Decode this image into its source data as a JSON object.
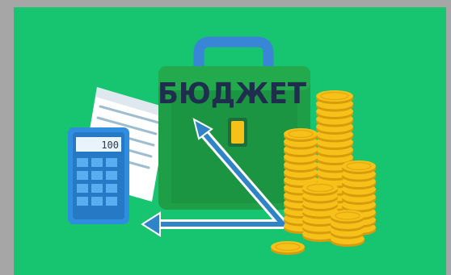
{
  "banner": {
    "title": "БЮДЖЕТ",
    "calculator_display": "100"
  },
  "colors": {
    "frame": "#a6a6a6",
    "background": "#17c470",
    "briefcase": "#1e9e47",
    "briefcase_dark": "#15803a",
    "handle": "#3a86d6",
    "arrow": "#2f84c8",
    "coin": "#f6c21a",
    "coin_edge": "#d89b0c",
    "calculator": "#2f8ee0",
    "title": "#1f2e4d"
  },
  "icons": {
    "briefcase": "briefcase-icon",
    "calculator": "calculator-icon",
    "document": "document-icon",
    "coins": "coin-stack-icon",
    "arrow": "axis-arrow-icon"
  }
}
